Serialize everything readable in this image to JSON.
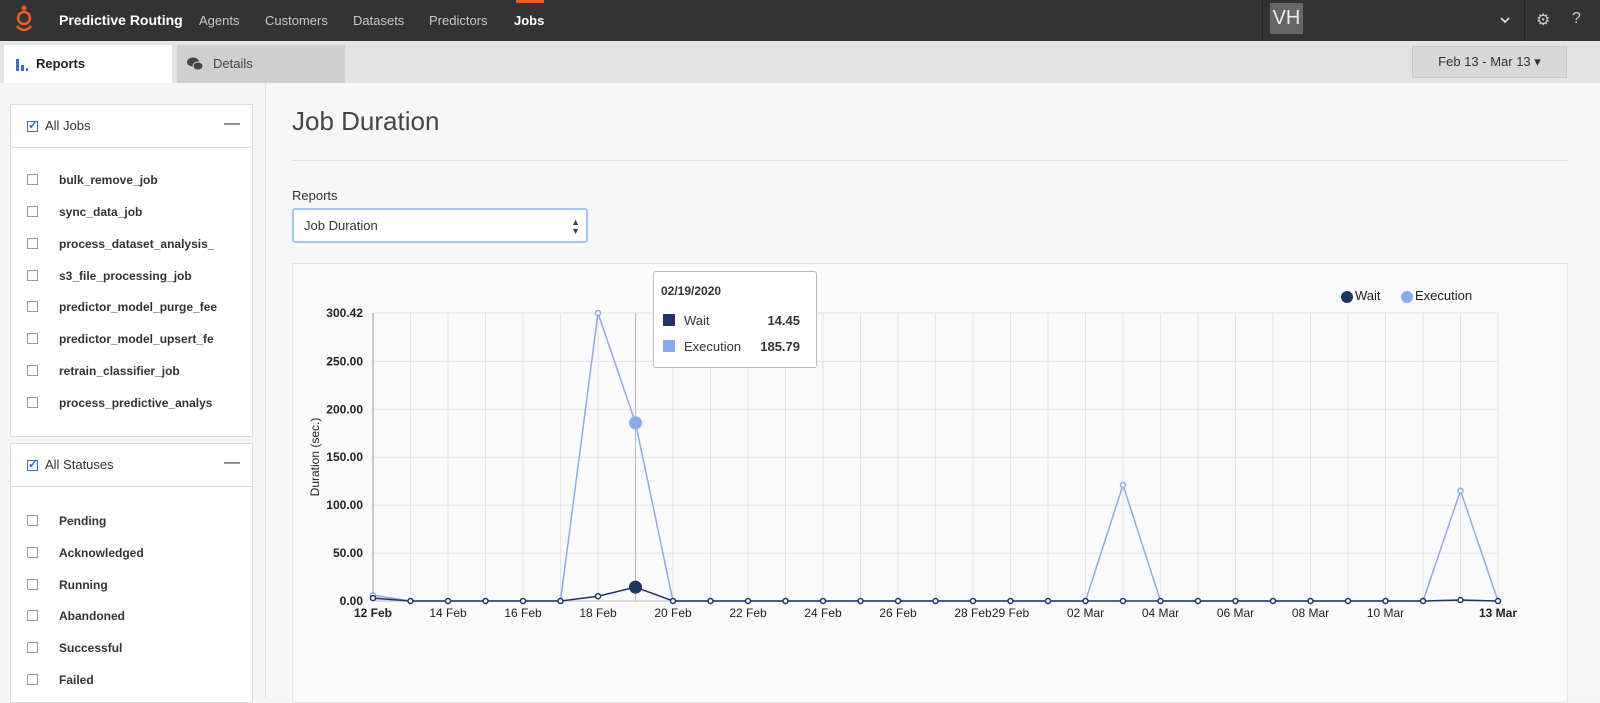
{
  "topbar": {
    "brand": "Predictive Routing",
    "nav": [
      "Agents",
      "Customers",
      "Datasets",
      "Predictors",
      "Jobs"
    ],
    "active_nav": "Jobs",
    "avatar_initials": "VH",
    "accent_color": "#f15a22"
  },
  "tabs": [
    {
      "label": "Reports",
      "icon": "bar-chart-icon"
    },
    {
      "label": "Details",
      "icon": "chat-bubbles-icon"
    }
  ],
  "date_range": "Feb 13 - Mar 13",
  "jobs_panel": {
    "header": "All Jobs",
    "checked": true,
    "items": [
      "bulk_remove_job",
      "sync_data_job",
      "process_dataset_analysis_",
      "s3_file_processing_job",
      "predictor_model_purge_fee",
      "predictor_model_upsert_fe",
      "retrain_classifier_job",
      "process_predictive_analys"
    ]
  },
  "status_panel": {
    "header": "All Statuses",
    "checked": true,
    "items": [
      "Pending",
      "Acknowledged",
      "Running",
      "Abandoned",
      "Successful",
      "Failed"
    ]
  },
  "main": {
    "title": "Job Duration",
    "reports_label": "Reports",
    "report_selected": "Job Duration"
  },
  "tooltip": {
    "date": "02/19/2020",
    "rows": [
      {
        "name": "Wait",
        "value": "14.45"
      },
      {
        "name": "Execution",
        "value": "185.79"
      }
    ]
  },
  "chart_data": {
    "type": "line",
    "ylabel": "Duration (sec.)",
    "xlabel": "",
    "ylim": [
      0,
      300.42
    ],
    "y_ticks": [
      "0.00",
      "50.00",
      "100.00",
      "150.00",
      "200.00",
      "250.00",
      "300.42"
    ],
    "x": [
      "12 Feb",
      "13 Feb",
      "14 Feb",
      "15 Feb",
      "16 Feb",
      "17 Feb",
      "18 Feb",
      "19 Feb",
      "20 Feb",
      "21 Feb",
      "22 Feb",
      "23 Feb",
      "24 Feb",
      "25 Feb",
      "26 Feb",
      "27 Feb",
      "28 Feb",
      "29 Feb",
      "01 Mar",
      "02 Mar",
      "03 Mar",
      "04 Mar",
      "05 Mar",
      "06 Mar",
      "07 Mar",
      "08 Mar",
      "09 Mar",
      "10 Mar",
      "11 Mar",
      "12 Mar",
      "13 Mar"
    ],
    "x_tick_labels": [
      {
        "i": 0,
        "label": "12 Feb",
        "bold": true
      },
      {
        "i": 2,
        "label": "14 Feb"
      },
      {
        "i": 4,
        "label": "16 Feb"
      },
      {
        "i": 6,
        "label": "18 Feb"
      },
      {
        "i": 8,
        "label": "20 Feb"
      },
      {
        "i": 10,
        "label": "22 Feb"
      },
      {
        "i": 12,
        "label": "24 Feb"
      },
      {
        "i": 14,
        "label": "26 Feb"
      },
      {
        "i": 16,
        "label": "28 Feb"
      },
      {
        "i": 17,
        "label": "29 Feb"
      },
      {
        "i": 19,
        "label": "02 Mar"
      },
      {
        "i": 21,
        "label": "04 Mar"
      },
      {
        "i": 23,
        "label": "06 Mar"
      },
      {
        "i": 25,
        "label": "08 Mar"
      },
      {
        "i": 27,
        "label": "10 Mar"
      },
      {
        "i": 30,
        "label": "13 Mar",
        "bold": true
      }
    ],
    "series": [
      {
        "name": "Wait",
        "color": "#1f3566",
        "values": [
          3,
          0,
          0,
          0,
          0,
          0,
          5,
          14.45,
          0,
          0,
          0,
          0,
          0,
          0,
          0,
          0,
          0,
          0,
          0,
          0,
          0,
          0,
          0,
          0,
          0,
          0,
          0,
          0,
          0,
          1,
          0
        ]
      },
      {
        "name": "Execution",
        "color": "#8aaaf0",
        "values": [
          6,
          0,
          0,
          0,
          0,
          0,
          300.42,
          185.79,
          0,
          0,
          0,
          0,
          0,
          0,
          0,
          0,
          0,
          0,
          0,
          0,
          121,
          0,
          0,
          0,
          0,
          0,
          0,
          0,
          0,
          115,
          0
        ]
      }
    ],
    "highlight_index": 7,
    "legend_position": "top-right",
    "grid": true
  }
}
